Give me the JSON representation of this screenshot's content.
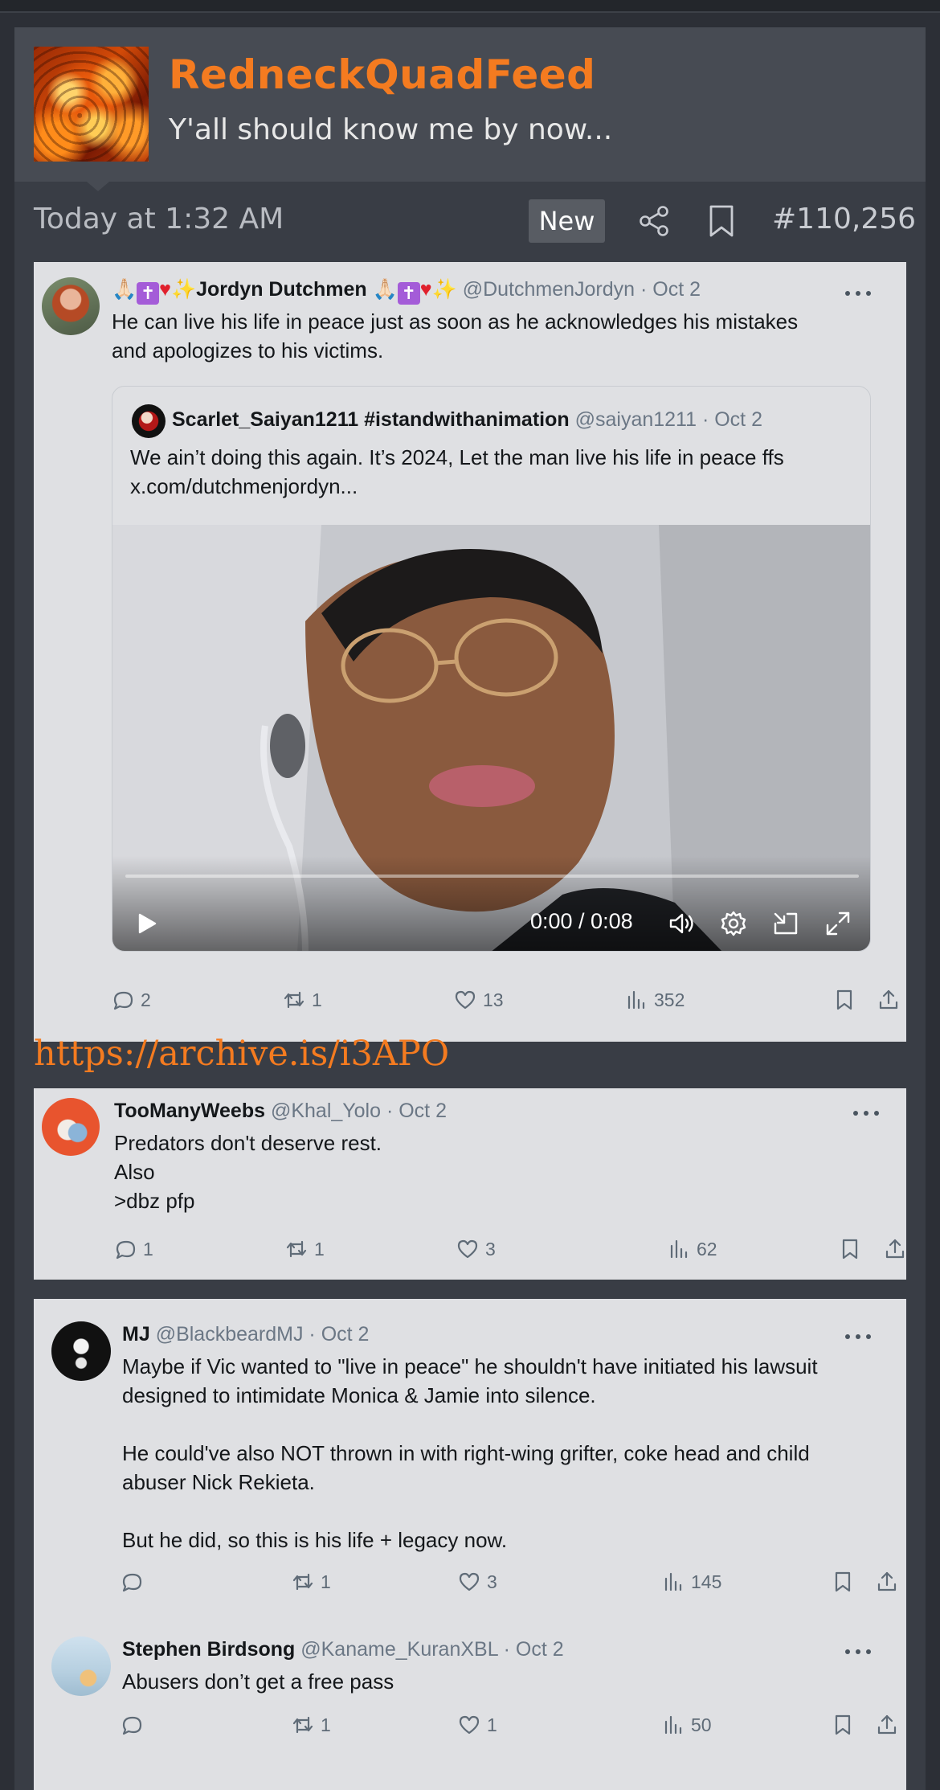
{
  "post": {
    "username": "RedneckQuadFeed",
    "user_title": "Y'all should know me by now...",
    "time": "Today at 1:32 AM",
    "new_badge": "New",
    "post_number": "#110,256",
    "archive_link": "https://archive.is/i3APO"
  },
  "tweets": [
    {
      "name": "Jordyn Dutchmen",
      "handle": "@DutchmenJordyn",
      "date": "· Oct 2",
      "text_lines": [
        "He can live his life in peace just as soon as he acknowledges his mistakes",
        "and apologizes to his victims."
      ],
      "quote": {
        "name": "Scarlet_Saiyan1211 #istandwithanimation",
        "handle": "@saiyan1211",
        "date": "· Oct 2",
        "text_lines": [
          "We ain’t doing this again. It’s 2024, Let the man live his life in peace ffs",
          "x.com/dutchmenjordyn..."
        ],
        "video_time": "0:00 / 0:08",
        "video_progress": 0
      },
      "replies": "2",
      "reposts": "1",
      "likes": "13",
      "views": "352"
    },
    {
      "name": "TooManyWeebs",
      "handle": "@Khal_Yolo",
      "date": "· Oct 2",
      "text_lines": [
        "Predators don't deserve rest.",
        "Also",
        ">dbz pfp"
      ],
      "replies": "1",
      "reposts": "1",
      "likes": "3",
      "views": "62"
    },
    {
      "name": "MJ",
      "handle": "@BlackbeardMJ",
      "date": "· Oct 2",
      "text_lines": [
        "Maybe if Vic wanted to \"live in peace\" he shouldn't have initiated his lawsuit",
        "designed to intimidate Monica & Jamie into silence.",
        "",
        "He could've also NOT thrown in with right-wing grifter, coke head and child",
        "abuser Nick Rekieta.",
        "",
        "But he did, so this is his life + legacy now."
      ],
      "replies": "",
      "reposts": "1",
      "likes": "3",
      "views": "145"
    },
    {
      "name": "Stephen Birdsong",
      "handle": "@Kaname_KuranXBL",
      "date": "· Oct 2",
      "text_lines": [
        "Abusers don’t get a free pass"
      ],
      "replies": "",
      "reposts": "1",
      "likes": "1",
      "views": "50"
    }
  ],
  "colors": {
    "accent": "#f47b20",
    "page_bg": "#2c2f36",
    "card_bg": "#393d45",
    "header_bg": "#474b53",
    "tweet_bg": "#dfe0e3"
  },
  "icons": [
    "share-icon",
    "bookmark-icon",
    "more-icon",
    "reply-icon",
    "repost-icon",
    "like-icon",
    "views-icon",
    "share-up-icon",
    "play-icon",
    "volume-icon",
    "settings-icon",
    "pip-icon",
    "fullscreen-icon",
    "heart-emoji",
    "cross-emoji",
    "praying-hands-emoji",
    "sparkles-emoji"
  ]
}
